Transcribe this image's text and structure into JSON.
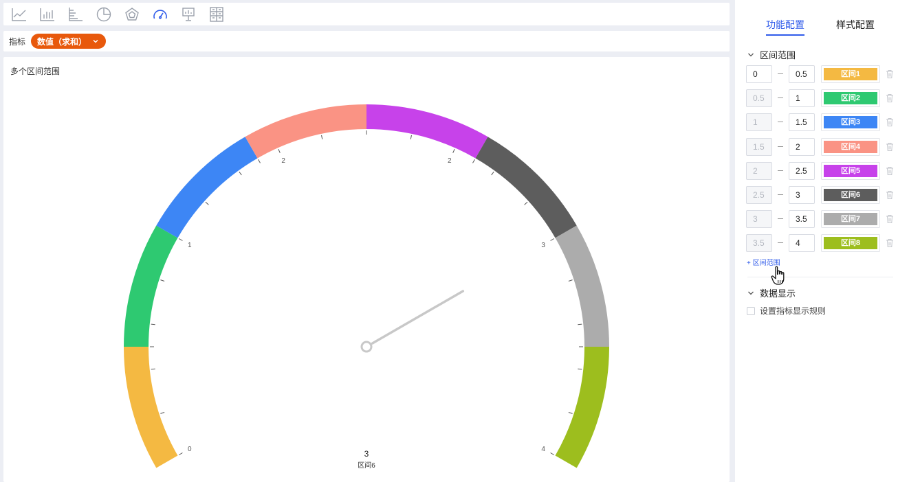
{
  "toolbar": {
    "icons": [
      "line-chart-icon",
      "bar-chart-icon",
      "horizontal-bar-chart-icon",
      "pie-chart-icon",
      "radar-chart-icon",
      "gauge-chart-icon",
      "map-board-icon",
      "pivot-table-icon"
    ],
    "active": "gauge-chart-icon"
  },
  "metric": {
    "label": "指标",
    "pill": "数值（求和）",
    "pill_color": "#e8590c"
  },
  "chart_data": {
    "type": "gauge",
    "title": "多个区间范围",
    "min": 0,
    "max": 4,
    "value": 3,
    "value_label": "3",
    "band_label": "区间6",
    "tick_labels": [
      {
        "value": 0,
        "text": "0"
      },
      {
        "value": 1,
        "text": "1"
      },
      {
        "value": 1.6,
        "text": "2"
      },
      {
        "value": 2.4,
        "text": "2"
      },
      {
        "value": 3,
        "text": "3"
      },
      {
        "value": 4,
        "text": "4"
      }
    ],
    "bands": [
      {
        "from": 0,
        "to": 0.5,
        "name": "区间1",
        "color": "#f4b942"
      },
      {
        "from": 0.5,
        "to": 1,
        "name": "区间2",
        "color": "#2ec971"
      },
      {
        "from": 1,
        "to": 1.5,
        "name": "区间3",
        "color": "#3d86f5"
      },
      {
        "from": 1.5,
        "to": 2,
        "name": "区间4",
        "color": "#fa9384"
      },
      {
        "from": 2,
        "to": 2.5,
        "name": "区间5",
        "color": "#c742ea"
      },
      {
        "from": 2.5,
        "to": 3,
        "name": "区间6",
        "color": "#5d5d5d"
      },
      {
        "from": 3,
        "to": 3.5,
        "name": "区间7",
        "color": "#acacac"
      },
      {
        "from": 3.5,
        "to": 4,
        "name": "区间8",
        "color": "#9dbe1e"
      }
    ],
    "needle_color": "#c8c8c8"
  },
  "right_panel": {
    "tabs": [
      {
        "label": "功能配置",
        "active": true
      },
      {
        "label": "样式配置",
        "active": false
      }
    ],
    "range_section_title": "区间范围",
    "ranges": [
      {
        "from": "0",
        "to": "0.5",
        "name": "区间1",
        "color": "#f4b942",
        "from_editable": true
      },
      {
        "from": "0.5",
        "to": "1",
        "name": "区间2",
        "color": "#2ec971",
        "from_editable": false
      },
      {
        "from": "1",
        "to": "1.5",
        "name": "区间3",
        "color": "#3d86f5",
        "from_editable": false
      },
      {
        "from": "1.5",
        "to": "2",
        "name": "区间4",
        "color": "#fa9384",
        "from_editable": false
      },
      {
        "from": "2",
        "to": "2.5",
        "name": "区间5",
        "color": "#c742ea",
        "from_editable": false
      },
      {
        "from": "2.5",
        "to": "3",
        "name": "区间6",
        "color": "#5d5d5d",
        "from_editable": false
      },
      {
        "from": "3",
        "to": "3.5",
        "name": "区间7",
        "color": "#acacac",
        "from_editable": false
      },
      {
        "from": "3.5",
        "to": "4",
        "name": "区间8",
        "color": "#9dbe1e",
        "from_editable": false
      }
    ],
    "add_range_label": "+ 区间范围",
    "data_section_title": "数据显示",
    "display_rule_label": "设置指标显示规则"
  }
}
